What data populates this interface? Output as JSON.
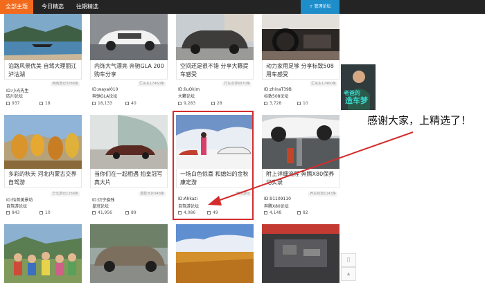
{
  "nav": {
    "tabs": [
      "全部主题",
      "今日精选",
      "往期精选"
    ],
    "manage_label": "+ 管理论坛"
  },
  "cards": [
    {
      "title": "泊路风景优美 自驾大理丽江泸沽湖",
      "source": "西南游记3088条",
      "author": "ID:小光先生",
      "forum": "四川论坛",
      "views": "937",
      "replies": "18"
    },
    {
      "title": "内饰大气漂亮 奔驰GLA 200购车分享",
      "source": "汇买车17460条",
      "author": "ID:wayaI010",
      "forum": "奔驰GLA论坛",
      "views": "18,133",
      "replies": "40"
    },
    {
      "title": "空间还是很不错 分享大籁提车感受",
      "source": "行车点评6870条",
      "author": "ID:liuOkim",
      "forum": "大籁论坛",
      "views": "9,283",
      "replies": "28"
    },
    {
      "title": "动力家用足够 分享标致508用车感受",
      "source": "汇买车17460条",
      "author": "ID:zhinaT39B",
      "forum": "标致508论坛",
      "views": "3,728",
      "replies": "10"
    },
    {
      "title": "多彩的秋天 河北内蒙古交界自驾游",
      "source": "华北游记1268条",
      "author": "ID:怡首美景坊",
      "forum": "自驾游论坛",
      "views": "843",
      "replies": "10"
    },
    {
      "title": "当你们在一起相遇 拍皇冠写真大片",
      "source": "摄影大片948条",
      "author": "ID:贝宁骁残",
      "forum": "皇冠论坛",
      "views": "41,956",
      "replies": "89"
    },
    {
      "title": "一场白色惊喜 和媳妇的金秋康定游",
      "source": "西南游记",
      "author": "ID:Ahkazi",
      "forum": "自驾游论坛",
      "views": "4,086",
      "replies": "49"
    },
    {
      "title": "附上详细流程 奔腾X80保养记实录",
      "source": "养车有道1143条",
      "author": "ID:91109110",
      "forum": "奔腾X80论坛",
      "views": "4,148",
      "replies": "82"
    }
  ],
  "annotation": {
    "text": "感谢大家，上精选了！"
  },
  "avatar": {
    "text": "老爸的造车梦"
  },
  "side_buttons": [
    "▯",
    "▴"
  ],
  "colors": {
    "active_tab": "#f26b1d",
    "nav_bg": "#242424",
    "manage_btn": "#1e8ecb",
    "highlight": "#d42c2c"
  }
}
